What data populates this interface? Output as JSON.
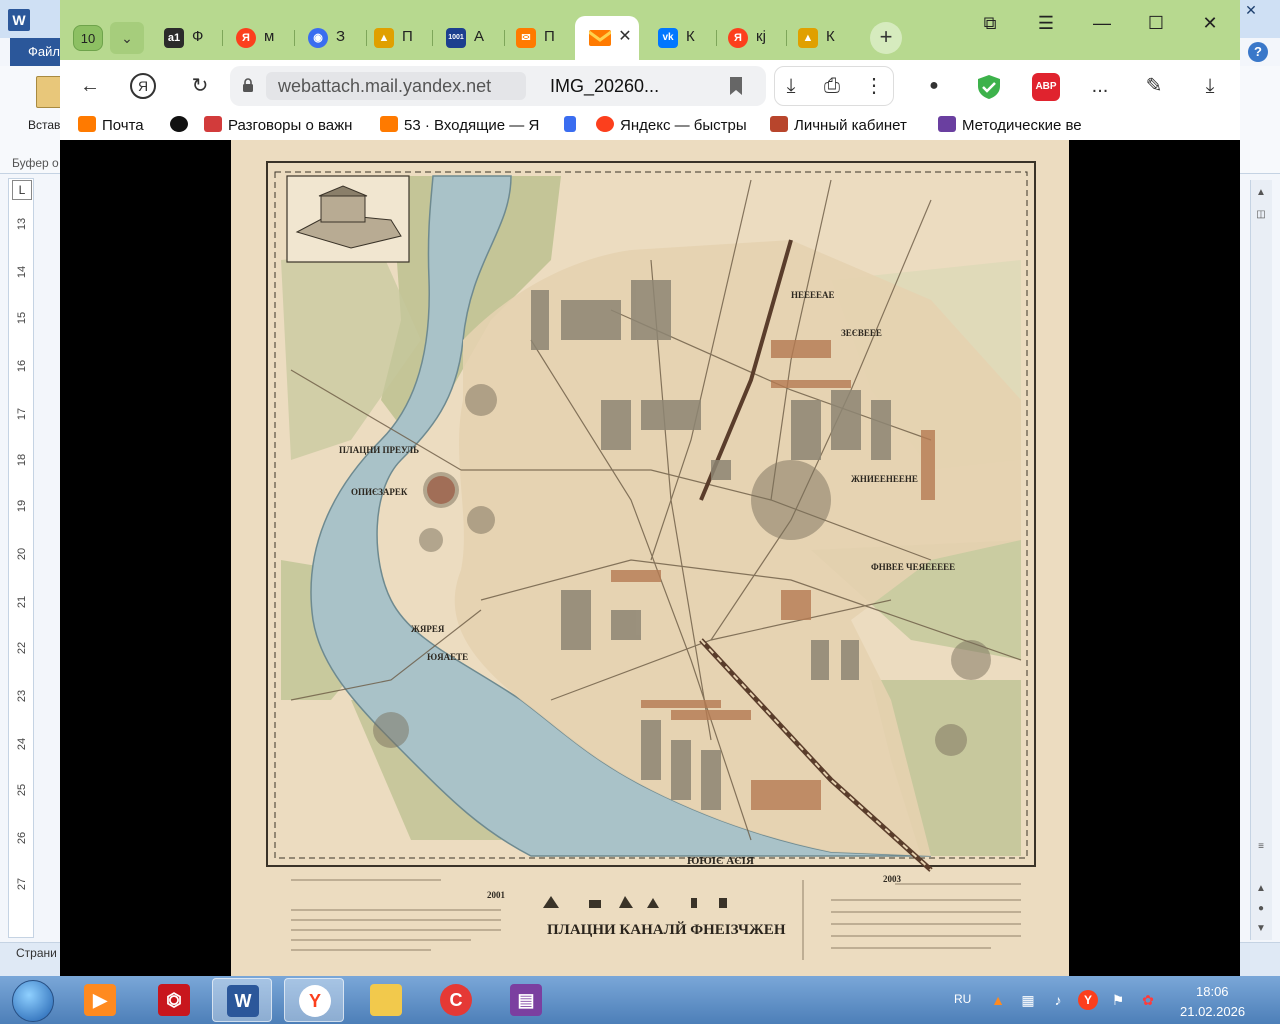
{
  "word": {
    "logo": "W",
    "file_tab": "Файл",
    "help": "?",
    "paste_label": "Встав",
    "clipboard_label": "Буфер о",
    "ruler_corner": "L",
    "ruler_numbers": [
      "13",
      "14",
      "15",
      "16",
      "17",
      "18",
      "19",
      "20",
      "21",
      "22",
      "23",
      "24",
      "25",
      "26",
      "27"
    ],
    "status_text": "Страни"
  },
  "browser": {
    "tab_counter": "10",
    "tabs": [
      {
        "icon_text": "a1",
        "label": "Ф",
        "color": "#2b2b2b"
      },
      {
        "icon_text": "Я",
        "label": "м",
        "color": "#fc3f1d"
      },
      {
        "icon_text": "◉",
        "label": "З",
        "color": "#3a6df0"
      },
      {
        "icon_text": "▲",
        "label": "П",
        "color": "#e0a000"
      },
      {
        "icon_text": "1001",
        "label": "А",
        "color": "#1c3f8f"
      },
      {
        "icon_text": "✉",
        "label": "П",
        "color": "#ff7a00"
      }
    ],
    "tabs_after": [
      {
        "icon_text": "vk",
        "label": "К",
        "color": "#0077ff"
      },
      {
        "icon_text": "Я",
        "label": "кј",
        "color": "#fc3f1d"
      },
      {
        "icon_text": "▲",
        "label": "К",
        "color": "#e0a000"
      }
    ],
    "active_tab_close": "✕",
    "new_tab": "+",
    "url": "webattach.mail.yandex.net",
    "page_title": "IMG_20260...",
    "menu_dots": "⋮",
    "more_ext": "...",
    "abp_label": "ABP",
    "bookmarks": [
      {
        "label": "Почта",
        "color": "#ff7a00"
      },
      {
        "label": "",
        "color": "#111111"
      },
      {
        "label": "Разговоры о важн",
        "color": "#d23b3b"
      },
      {
        "label": "53 · Входящие — Я",
        "color": "#ff7a00"
      },
      {
        "label": "",
        "color": "#3a6df0"
      },
      {
        "label": "Яндекс — быстры",
        "color": "#fc3f1d"
      },
      {
        "label": "Личный кабинет",
        "color": "#b8452c"
      },
      {
        "label": "Методические ве",
        "color": "#6a3fa0"
      }
    ]
  },
  "map": {
    "legend_title": "ПЛАЦНИ КАНАЛЙ ФНЕІЗЧЖЕН",
    "river_label": "ЮЮІЄ АЄІЯ",
    "left_labels": [
      "ПЛАЦНИ ПРЕУЛЬ",
      "ОПИЄЗАРЕК",
      "ЖЯРЕЯ",
      "ЮЯАЕТЕ"
    ],
    "right_labels": [
      "ФНВЕЕ ЧЕЯЕЕЕЕЕ",
      "ЖНИЕЕНЕЕНЕ",
      "ЗЕЄВЕЕЕ",
      "НЕЕЕЕАЕ"
    ],
    "legend_number": "2001",
    "corner_number": "2003"
  },
  "taskbar": {
    "language": "RU",
    "time": "18:06",
    "date": "21.02.2026"
  }
}
